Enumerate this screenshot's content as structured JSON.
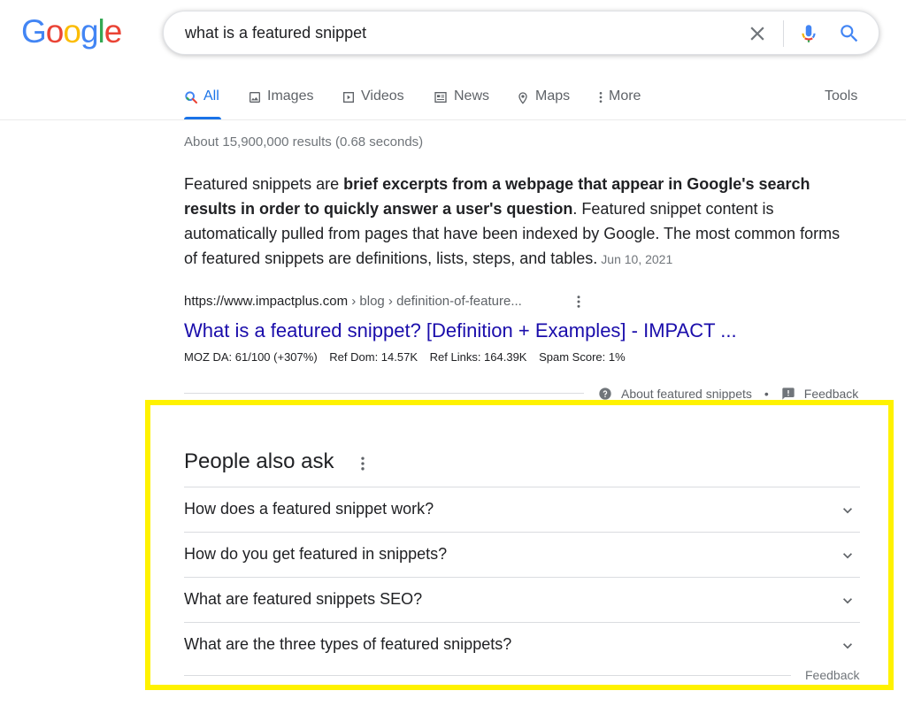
{
  "logo": {
    "letters": [
      "G",
      "o",
      "o",
      "g",
      "l",
      "e"
    ],
    "colors": [
      "#4285F4",
      "#EA4335",
      "#FBBC05",
      "#4285F4",
      "#34A853",
      "#EA4335"
    ]
  },
  "search": {
    "query": "what is a featured snippet"
  },
  "tabs": [
    {
      "label": "All",
      "icon": "search-icon",
      "active": true
    },
    {
      "label": "Images",
      "icon": "image-icon"
    },
    {
      "label": "Videos",
      "icon": "video-icon"
    },
    {
      "label": "News",
      "icon": "news-icon"
    },
    {
      "label": "Maps",
      "icon": "map-pin-icon"
    },
    {
      "label": "More",
      "icon": "more-vert-icon"
    }
  ],
  "tools_label": "Tools",
  "result_stats": "About 15,900,000 results (0.68 seconds)",
  "featured_snippet": {
    "text_1": "Featured snippets are ",
    "bold": "brief excerpts from a webpage that appear in Google's search results in order to quickly answer a user's question",
    "text_2": ". Featured snippet content is automatically pulled from pages that have been indexed by Google. The most common forms of featured snippets are definitions, lists, steps, and tables.",
    "date": "Jun 10, 2021"
  },
  "result": {
    "url": "https://www.impactplus.com",
    "breadcrumbs": " › blog › definition-of-feature...",
    "title": "What is a featured snippet? [Definition + Examples] - IMPACT ...",
    "metrics": [
      "MOZ DA: 61/100 (+307%)",
      "Ref Dom: 14.57K",
      "Ref Links: 164.39K",
      "Spam Score: 1%"
    ]
  },
  "snippet_footer": {
    "about_label": "About featured snippets",
    "separator": "•",
    "feedback_label": "Feedback"
  },
  "people_also_ask": {
    "title": "People also ask",
    "questions": [
      "How does a featured snippet work?",
      "How do you get featured in snippets?",
      "What are featured snippets SEO?",
      "What are the three types of featured snippets?"
    ],
    "feedback_label": "Feedback",
    "highlight_color": "#fff200"
  },
  "colors": {
    "accent": "#1a73e8",
    "link": "#1a0dab",
    "secondary_text": "#70757a"
  }
}
